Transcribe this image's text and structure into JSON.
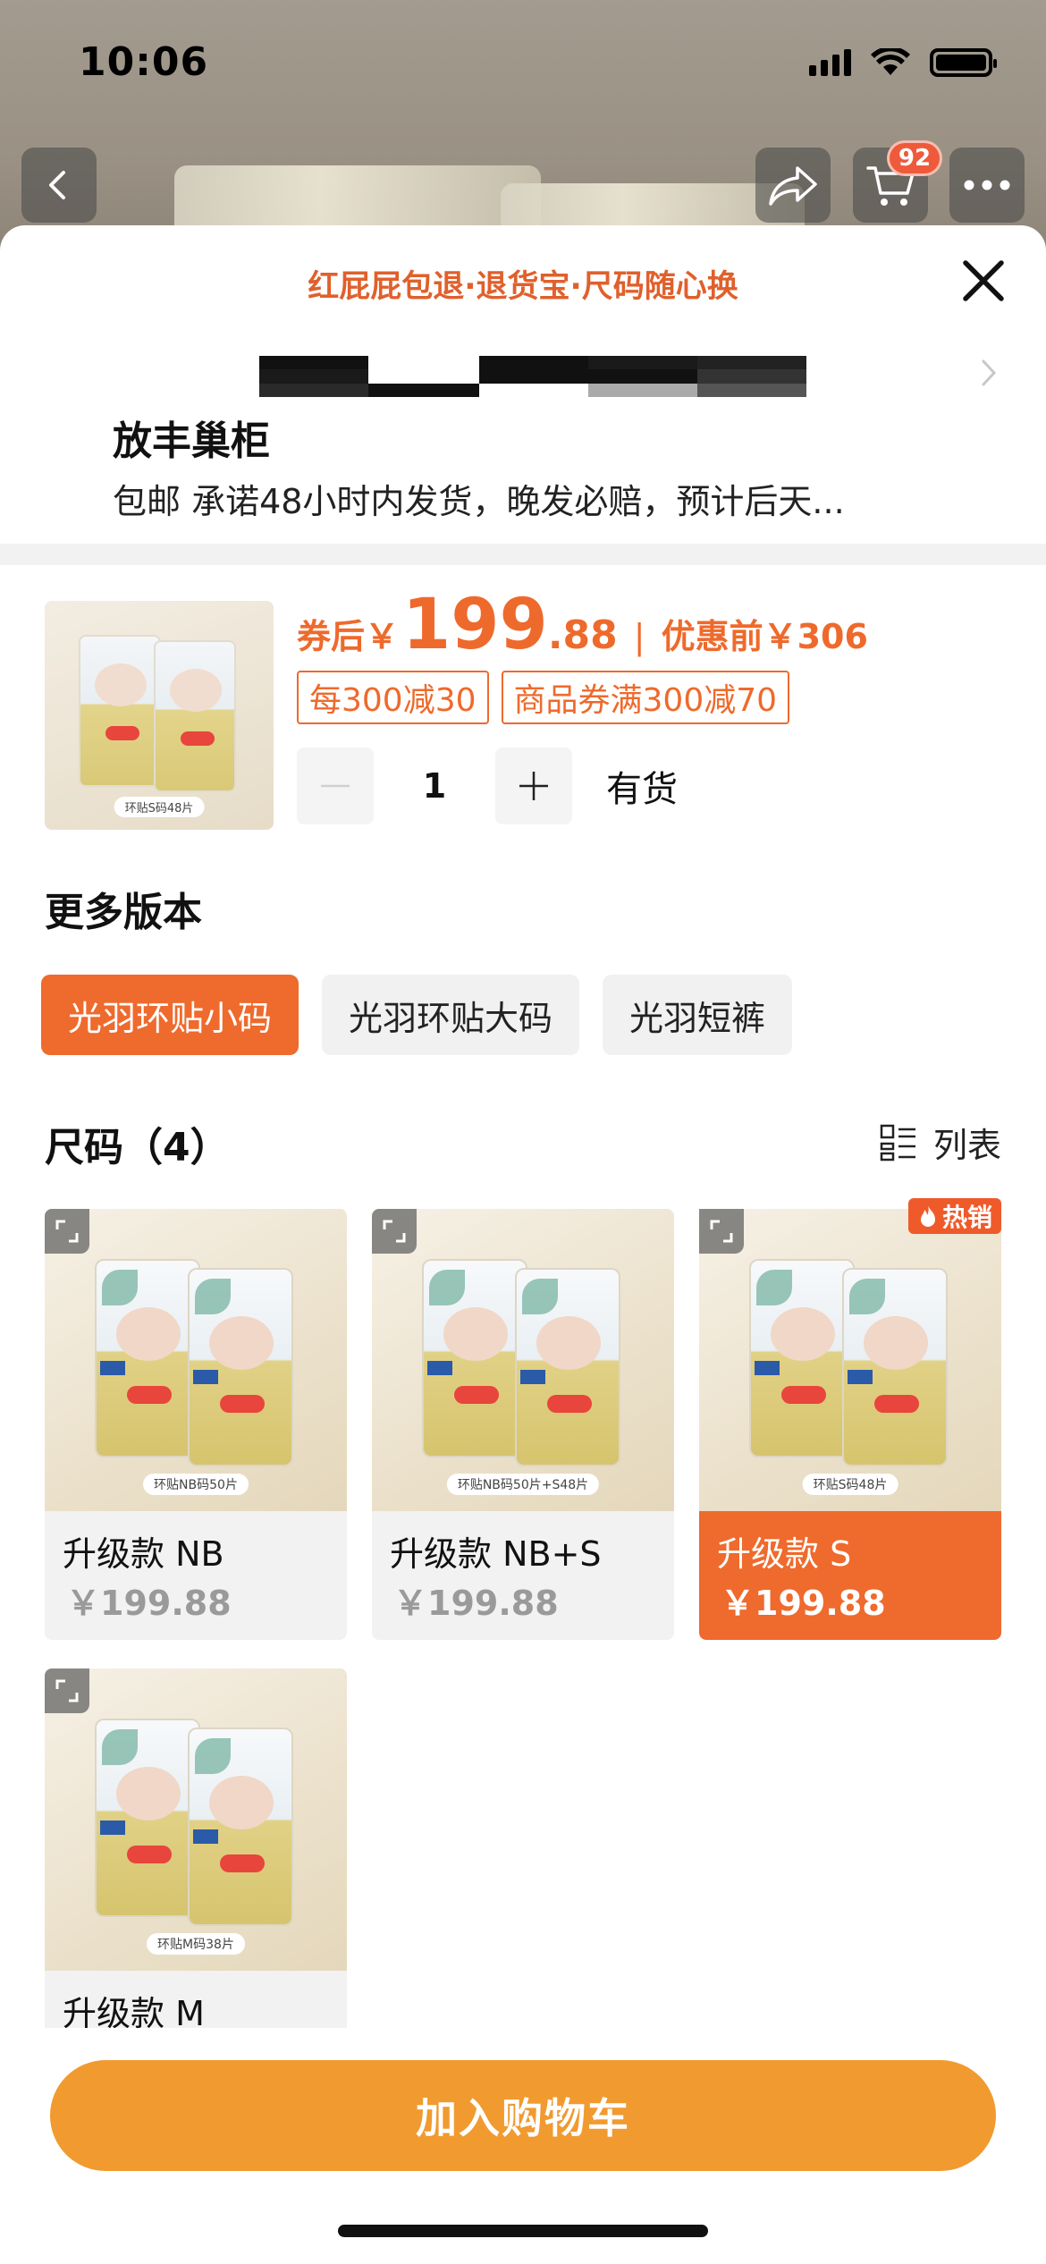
{
  "status_bar": {
    "time": "10:06"
  },
  "top_bar": {
    "cart_count": "92"
  },
  "sheet": {
    "guarantee": "红屁屁包退·退货宝·尺码随心换",
    "address": {
      "title": "放丰巢柜",
      "detail": "包邮 承诺48小时内发货，晚发必赔，预计后天..."
    },
    "product": {
      "thumb_caption": "环贴S码48片",
      "price_label": "券后￥",
      "price_int": "199",
      "price_dec": ".88",
      "price_sep": "|",
      "price_before": "优惠前￥306",
      "coupons": [
        "每300减30",
        "商品券满300减70"
      ],
      "quantity": "1",
      "stock": "有货"
    },
    "versions": {
      "title": "更多版本",
      "items": [
        "光羽环贴小码",
        "光羽环贴大码",
        "光羽短裤"
      ],
      "selected": 0
    },
    "sizes": {
      "title": "尺码（4）",
      "view_label": "列表",
      "hot_label": "热销",
      "items": [
        {
          "caption": "环贴NB码50片",
          "name": "升级款 NB",
          "price": "￥199.88"
        },
        {
          "caption": "环贴NB码50片+S48片",
          "name": "升级款 NB+S",
          "price": "￥199.88"
        },
        {
          "caption": "环贴S码48片",
          "name": "升级款 S",
          "price": "￥199.88"
        },
        {
          "caption": "环贴M码38片",
          "name": "升级款 M",
          "price": ""
        }
      ],
      "selected": 2
    },
    "cta": "加入购物车"
  },
  "colors": {
    "accent": "#ef6a2d",
    "price": "#ee6a2c",
    "cta": "#f19a2f",
    "badge": "#ee5a3b"
  }
}
